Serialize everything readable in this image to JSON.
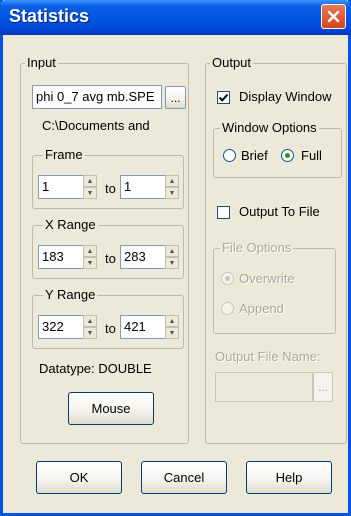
{
  "window": {
    "title": "Statistics"
  },
  "input": {
    "legend": "Input",
    "filename": "phi 0_7 avg mb.SPE",
    "browse_label": "...",
    "path": "C:\\Documents and",
    "frame": {
      "legend": "Frame",
      "from": "1",
      "to_label": "to",
      "to": "1"
    },
    "xrange": {
      "legend": "X Range",
      "from": "183",
      "to_label": "to",
      "to": "283"
    },
    "yrange": {
      "legend": "Y Range",
      "from": "322",
      "to_label": "to",
      "to": "421"
    },
    "datatype": "Datatype:  DOUBLE",
    "mouse_label": "Mouse"
  },
  "output": {
    "legend": "Output",
    "display_window": {
      "label": "Display Window",
      "checked": true
    },
    "window_options": {
      "legend": "Window Options",
      "brief": "Brief",
      "full": "Full",
      "selected": "Full"
    },
    "output_to_file": {
      "label": "Output To File",
      "checked": false
    },
    "file_options": {
      "legend": "File Options",
      "overwrite": "Overwrite",
      "append": "Append",
      "selected": "Overwrite"
    },
    "output_file_name_label": "Output File Name:",
    "output_file_name": "",
    "browse_label": "..."
  },
  "buttons": {
    "ok": "OK",
    "cancel": "Cancel",
    "help": "Help"
  },
  "colors": {
    "titlebar": "#0054e3",
    "close": "#d2451e",
    "face": "#ece9d8",
    "disabled_text": "#aca899"
  }
}
